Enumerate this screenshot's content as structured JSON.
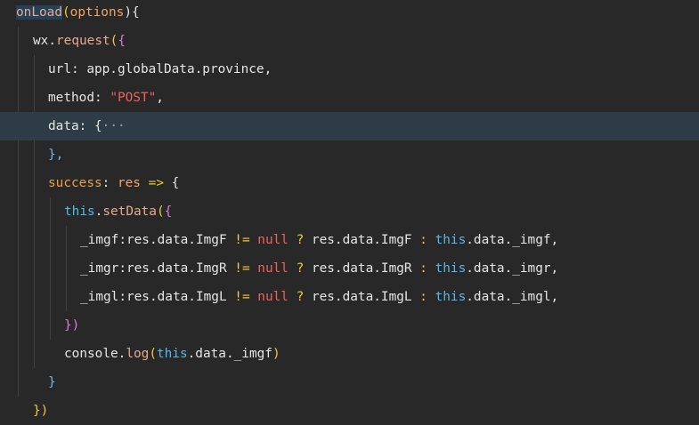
{
  "editor": {
    "lines": [
      {
        "tokens": [
          {
            "t": "onLoad",
            "c": "tok-fn hl-word"
          },
          {
            "t": "(",
            "c": "tok-paren"
          },
          {
            "t": "options",
            "c": "tok-param"
          },
          {
            "t": "){",
            "c": "tok-text"
          }
        ]
      },
      {
        "tokens": [
          {
            "t": "wx",
            "c": "tok-text"
          },
          {
            "t": ".",
            "c": "tok-text"
          },
          {
            "t": "request",
            "c": "tok-fn"
          },
          {
            "t": "(",
            "c": "tok-paren"
          },
          {
            "t": "{",
            "c": "tok-brace"
          }
        ]
      },
      {
        "tokens": [
          {
            "t": "url: app.globalData.province,",
            "c": "tok-text"
          }
        ]
      },
      {
        "tokens": [
          {
            "t": "method: ",
            "c": "tok-text"
          },
          {
            "t": "\"POST\"",
            "c": "tok-str"
          },
          {
            "t": ",",
            "c": "tok-text"
          }
        ]
      },
      {
        "tokens": [
          {
            "t": "data: {",
            "c": "tok-text"
          },
          {
            "t": "···",
            "c": "tok-dim"
          }
        ]
      },
      {
        "tokens": [
          {
            "t": "},",
            "c": "tok-brace2"
          }
        ]
      },
      {
        "tokens": [
          {
            "t": "success",
            "c": "tok-kw"
          },
          {
            "t": ": ",
            "c": "tok-text"
          },
          {
            "t": "res",
            "c": "tok-param"
          },
          {
            "t": " ",
            "c": "tok-text"
          },
          {
            "t": "=>",
            "c": "tok-op"
          },
          {
            "t": " {",
            "c": "tok-text"
          }
        ]
      },
      {
        "tokens": [
          {
            "t": "this",
            "c": "tok-this"
          },
          {
            "t": ".",
            "c": "tok-text"
          },
          {
            "t": "setData",
            "c": "tok-fn"
          },
          {
            "t": "(",
            "c": "tok-paren"
          },
          {
            "t": "{",
            "c": "tok-brace"
          }
        ]
      },
      {
        "tokens": [
          {
            "t": "_imgf:res.data.ImgF ",
            "c": "tok-text"
          },
          {
            "t": "!=",
            "c": "tok-op"
          },
          {
            "t": " ",
            "c": "tok-text"
          },
          {
            "t": "null",
            "c": "tok-null"
          },
          {
            "t": " ",
            "c": "tok-text"
          },
          {
            "t": "?",
            "c": "tok-op"
          },
          {
            "t": " res.data.ImgF ",
            "c": "tok-text"
          },
          {
            "t": ":",
            "c": "tok-op"
          },
          {
            "t": " ",
            "c": "tok-text"
          },
          {
            "t": "this",
            "c": "tok-this"
          },
          {
            "t": ".data._imgf,",
            "c": "tok-text"
          }
        ]
      },
      {
        "tokens": [
          {
            "t": "_imgr:res.data.ImgR ",
            "c": "tok-text"
          },
          {
            "t": "!=",
            "c": "tok-op"
          },
          {
            "t": " ",
            "c": "tok-text"
          },
          {
            "t": "null",
            "c": "tok-null"
          },
          {
            "t": " ",
            "c": "tok-text"
          },
          {
            "t": "?",
            "c": "tok-op"
          },
          {
            "t": " res.data.ImgR ",
            "c": "tok-text"
          },
          {
            "t": ":",
            "c": "tok-op"
          },
          {
            "t": " ",
            "c": "tok-text"
          },
          {
            "t": "this",
            "c": "tok-this"
          },
          {
            "t": ".data._imgr,",
            "c": "tok-text"
          }
        ]
      },
      {
        "tokens": [
          {
            "t": "_imgl:res.data.ImgL ",
            "c": "tok-text"
          },
          {
            "t": "!=",
            "c": "tok-op"
          },
          {
            "t": " ",
            "c": "tok-text"
          },
          {
            "t": "null",
            "c": "tok-null"
          },
          {
            "t": " ",
            "c": "tok-text"
          },
          {
            "t": "?",
            "c": "tok-op"
          },
          {
            "t": " res.data.ImgL ",
            "c": "tok-text"
          },
          {
            "t": ":",
            "c": "tok-op"
          },
          {
            "t": " ",
            "c": "tok-text"
          },
          {
            "t": "this",
            "c": "tok-this"
          },
          {
            "t": ".data._imgl,",
            "c": "tok-text"
          }
        ]
      },
      {
        "tokens": [
          {
            "t": "})",
            "c": "tok-brace"
          }
        ]
      },
      {
        "tokens": [
          {
            "t": "console.",
            "c": "tok-text"
          },
          {
            "t": "log",
            "c": "tok-fn"
          },
          {
            "t": "(",
            "c": "tok-paren"
          },
          {
            "t": "this",
            "c": "tok-this"
          },
          {
            "t": ".data._imgf",
            "c": "tok-text"
          },
          {
            "t": ")",
            "c": "tok-paren"
          }
        ]
      },
      {
        "tokens": [
          {
            "t": "}",
            "c": "tok-brace2"
          }
        ]
      },
      {
        "tokens": [
          {
            "t": "})",
            "c": "tok-paren"
          }
        ]
      }
    ]
  },
  "colors": {
    "background": "#282828",
    "current_line": "#2e3c47",
    "indent_guide": "#3f3f3f"
  }
}
